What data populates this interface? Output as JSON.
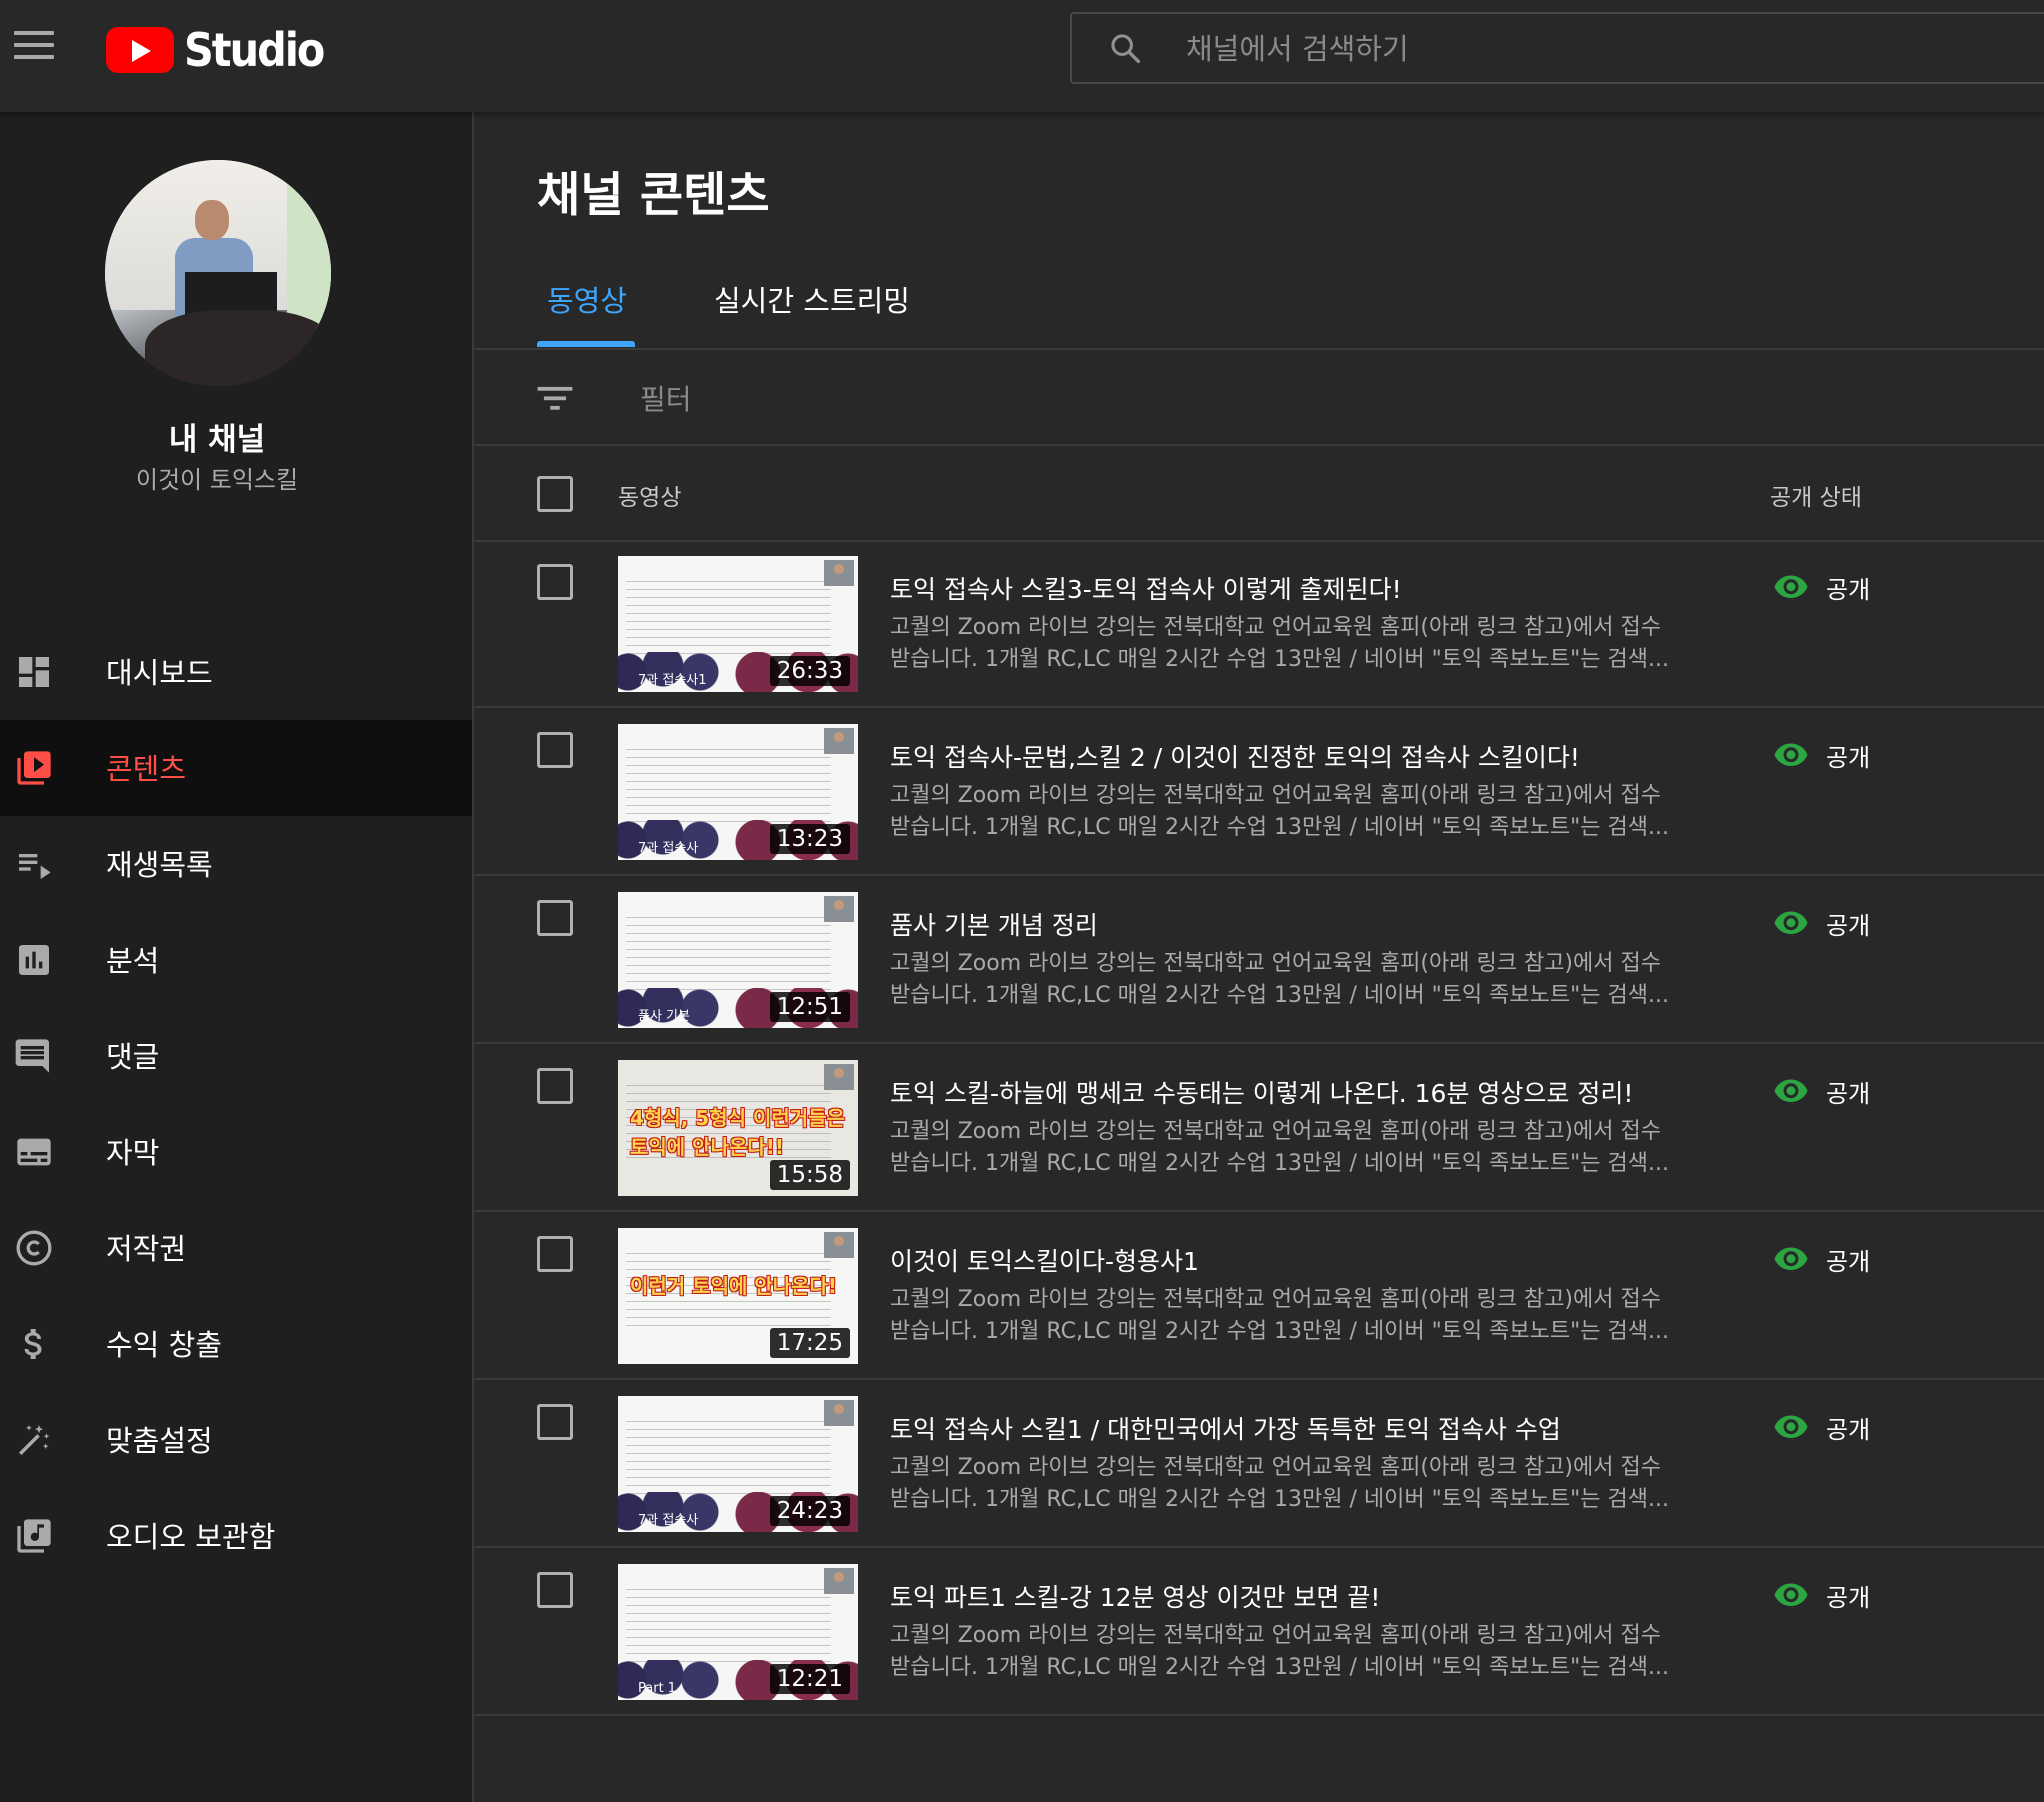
{
  "app": {
    "logo_text": "Studio"
  },
  "search": {
    "placeholder": "채널에서 검색하기"
  },
  "sidebar": {
    "channel_label": "내 채널",
    "channel_name": "이것이 토익스킬",
    "items": [
      {
        "label": "대시보드",
        "icon": "dashboard-icon",
        "active": false
      },
      {
        "label": "콘텐츠",
        "icon": "content-icon",
        "active": true
      },
      {
        "label": "재생목록",
        "icon": "playlist-icon",
        "active": false
      },
      {
        "label": "분석",
        "icon": "analytics-icon",
        "active": false
      },
      {
        "label": "댓글",
        "icon": "comments-icon",
        "active": false
      },
      {
        "label": "자막",
        "icon": "subtitles-icon",
        "active": false
      },
      {
        "label": "저작권",
        "icon": "copyright-icon",
        "active": false
      },
      {
        "label": "수익 창출",
        "icon": "dollar-icon",
        "active": false
      },
      {
        "label": "맞춤설정",
        "icon": "magic-wand-icon",
        "active": false
      },
      {
        "label": "오디오 보관함",
        "icon": "audio-library-icon",
        "active": false
      }
    ]
  },
  "main": {
    "title": "채널 콘텐츠",
    "tabs": [
      {
        "label": "동영상",
        "active": true
      },
      {
        "label": "실시간 스트리밍",
        "active": false
      }
    ],
    "filter_label": "필터",
    "columns": {
      "video": "동영상",
      "visibility": "공개 상태"
    },
    "videos": [
      {
        "title": "토익 접속사 스킬3-토익 접속사 이렇게 출제된다!",
        "duration": "26:33",
        "thumb_caption": "7과 접속사1",
        "desc1": "고퀄의 Zoom 라이브 강의는 전북대학교 언어교육원 홈피(아래 링크 참고)에서 접수",
        "desc2": "받습니다. 1개월 RC,LC 매일 2시간 수업 13만원 / 네이버 \"토익 족보노트\"는 검색...",
        "visibility": "공개"
      },
      {
        "title": "토익 접속사-문법,스킬 2 / 이것이 진정한 토익의 접속사 스킬이다!",
        "duration": "13:23",
        "thumb_caption": "7과 접속사",
        "desc1": "고퀄의 Zoom 라이브 강의는 전북대학교 언어교육원 홈피(아래 링크 참고)에서 접수",
        "desc2": "받습니다. 1개월 RC,LC 매일 2시간 수업 13만원 / 네이버 \"토익 족보노트\"는 검색...",
        "visibility": "공개"
      },
      {
        "title": "품사 기본 개념 정리",
        "duration": "12:51",
        "thumb_caption": "품사 기본",
        "desc1": "고퀄의 Zoom 라이브 강의는 전북대학교 언어교육원 홈피(아래 링크 참고)에서 접수",
        "desc2": "받습니다. 1개월 RC,LC 매일 2시간 수업 13만원 / 네이버 \"토익 족보노트\"는 검색...",
        "visibility": "공개"
      },
      {
        "title": "토익 스킬-하늘에 맹세코 수동태는 이렇게 나온다. 16분 영상으로 정리!",
        "duration": "15:58",
        "thumb_caption": "",
        "thumb_big": "4형식, 5형식 이런거들은 토익에 안나온다!!",
        "desc1": "고퀄의 Zoom 라이브 강의는 전북대학교 언어교육원 홈피(아래 링크 참고)에서 접수",
        "desc2": "받습니다. 1개월 RC,LC 매일 2시간 수업 13만원 / 네이버 \"토익 족보노트\"는 검색...",
        "visibility": "공개"
      },
      {
        "title": "이것이 토익스킬이다-형용사1",
        "duration": "17:25",
        "thumb_caption": "",
        "thumb_big": "이런거 토익에 안나온다!",
        "desc1": "고퀄의 Zoom 라이브 강의는 전북대학교 언어교육원 홈피(아래 링크 참고)에서 접수",
        "desc2": "받습니다. 1개월 RC,LC 매일 2시간 수업 13만원 / 네이버 \"토익 족보노트\"는 검색...",
        "visibility": "공개"
      },
      {
        "title": "토익 접속사 스킬1 / 대한민국에서 가장 독특한 토익 접속사 수업",
        "duration": "24:23",
        "thumb_caption": "7과 접속사",
        "desc1": "고퀄의 Zoom 라이브 강의는 전북대학교 언어교육원 홈피(아래 링크 참고)에서 접수",
        "desc2": "받습니다. 1개월 RC,LC 매일 2시간 수업 13만원 / 네이버 \"토익 족보노트\"는 검색...",
        "visibility": "공개"
      },
      {
        "title": "토익 파트1 스킬-강 12분 영상 이것만 보면 끝!",
        "duration": "12:21",
        "thumb_caption": "Part 1",
        "desc1": "고퀄의 Zoom 라이브 강의는 전북대학교 언어교육원 홈피(아래 링크 참고)에서 접수",
        "desc2": "받습니다. 1개월 RC,LC 매일 2시간 수업 13만원 / 네이버 \"토익 족보노트\"는 검색...",
        "visibility": "공개"
      }
    ]
  },
  "colors": {
    "accent_blue": "#3ea6ff",
    "active_red": "#ff4e45",
    "public_green": "#2ba640",
    "youtube_red": "#ff0000"
  }
}
